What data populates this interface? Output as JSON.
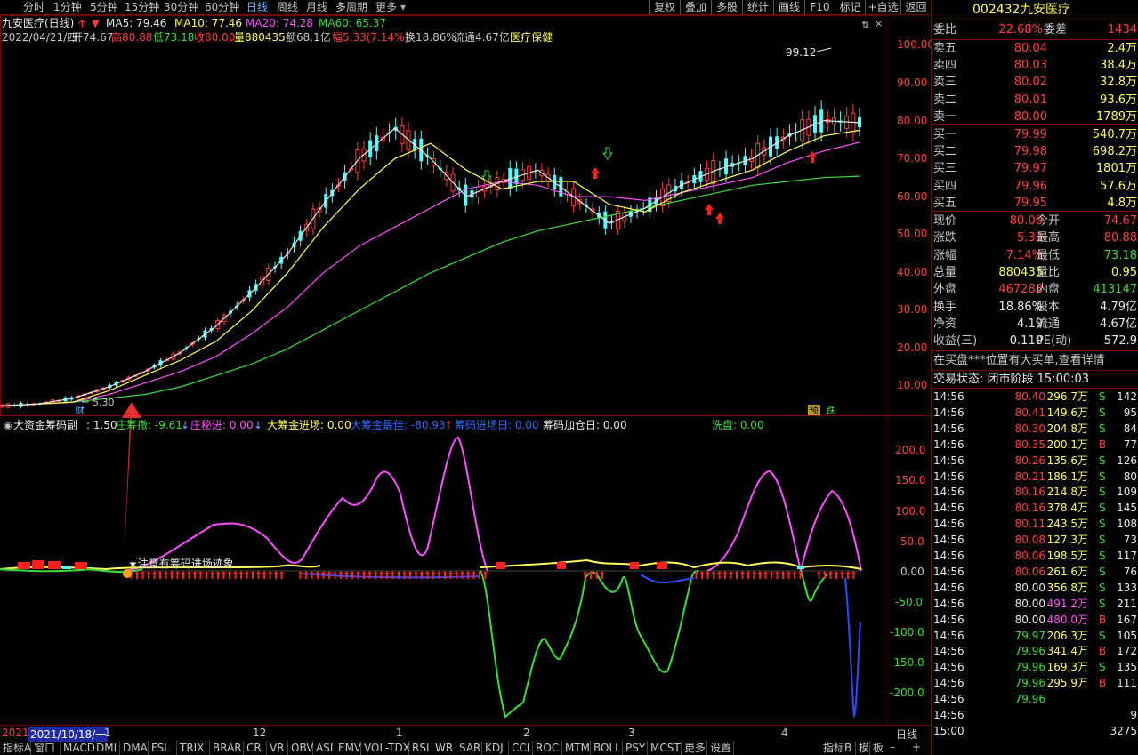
{
  "toolbar": {
    "periods": [
      "分时",
      "1分钟",
      "5分钟",
      "15分钟",
      "30分钟",
      "60分钟",
      "日线",
      "周线",
      "月线",
      "多周期",
      "更多"
    ],
    "active_period": "日线",
    "buttons": [
      "复权",
      "叠加",
      "多股",
      "统计",
      "画线",
      "F10",
      "标记",
      "+自选",
      "返回"
    ]
  },
  "main_chart": {
    "title": "九安医疗(日线)",
    "ma5": "MA5: 79.46",
    "ma10": "MA10: 77.46",
    "ma20": "MA20: 74.28",
    "ma60": "MA60: 65.37",
    "info_date": "2022/04/21/四",
    "info_open": "开74.67",
    "info_high": "高80.88",
    "info_low": "低73.18",
    "info_close": "收80.00",
    "info_vol": "量880435",
    "info_amount": "额68.1亿",
    "info_change": "幅5.33(7.14%)",
    "info_turnover": "换18.86%",
    "info_float": "流通4.67亿",
    "info_sector": "医疗保健",
    "y_labels": [
      "100.00",
      "90.00",
      "80.00",
      "70.00",
      "60.00",
      "50.00",
      "40.00",
      "30.00",
      "20.00",
      "10.00"
    ],
    "max_label": "99.12",
    "min_label": "5.30",
    "tag_cai": "财",
    "tag_yu": "预",
    "tag_die": "跌"
  },
  "chart_data": {
    "type": "line",
    "x_ticks": [
      "2021",
      "2021/10/18/一",
      "1",
      "12",
      "1",
      "2",
      "3",
      "4"
    ],
    "series": [
      {
        "name": "MA60",
        "color": "#3cdc3c",
        "values": [
          5,
          5.5,
          6,
          7,
          8,
          10,
          13,
          16,
          20,
          25,
          30,
          35,
          40,
          44,
          48,
          51,
          53,
          55,
          57,
          59,
          61,
          63,
          64,
          65,
          65.37
        ]
      },
      {
        "name": "MA20",
        "color": "#ff50ff",
        "values": [
          5,
          5.5,
          6,
          8,
          11,
          14,
          18,
          24,
          31,
          40,
          47,
          52,
          57,
          62,
          64,
          63,
          60,
          60,
          59,
          61,
          63,
          65,
          69,
          72,
          74.28
        ]
      },
      {
        "name": "MA10",
        "color": "#ffff54",
        "values": [
          5,
          5.5,
          6,
          9,
          13,
          17,
          22,
          30,
          40,
          52,
          62,
          70,
          74,
          67,
          62,
          64,
          64,
          58,
          56,
          61,
          64,
          67,
          72,
          76,
          77.46
        ]
      },
      {
        "name": "MA5",
        "color": "#e8e8e8",
        "values": [
          5,
          5.5,
          7,
          10,
          14,
          19,
          26,
          35,
          45,
          58,
          70,
          78,
          70,
          60,
          64,
          67,
          60,
          53,
          57,
          63,
          67,
          70,
          76,
          80,
          79.46
        ]
      }
    ],
    "ylim": [
      0,
      110
    ]
  },
  "indicator": {
    "title": "大资金筹码副",
    "params": ": 1.50",
    "l1": "庄筹撤: -9.61",
    "l2": "庄秘进: 0.00",
    "l3": "大筹金进场: 0.00",
    "l4": "大筹金最佳: -80.93",
    "l5": "筹码进场日: 0.00",
    "l6": "筹码加仓日: 0.00",
    "l7": "洗盘: 0.00",
    "note": "★注意有筹码进场迹象",
    "y_labels": [
      "200.0",
      "150.0",
      "100.0",
      "50.0",
      "0.00",
      "-50.0",
      "-100.0",
      "-150.0",
      "-200.0"
    ]
  },
  "right_panel": {
    "code": "002432",
    "name": "九安医疗",
    "weibi_label": "委比",
    "weibi": "22.68%",
    "weicha_label": "委差",
    "weicha": "1434",
    "asks": [
      {
        "label": "卖五",
        "price": "80.04",
        "vol": "2.4万"
      },
      {
        "label": "卖四",
        "price": "80.03",
        "vol": "38.4万"
      },
      {
        "label": "卖三",
        "price": "80.02",
        "vol": "32.8万"
      },
      {
        "label": "卖二",
        "price": "80.01",
        "vol": "93.6万"
      },
      {
        "label": "卖一",
        "price": "80.00",
        "vol": "1789万"
      }
    ],
    "bids": [
      {
        "label": "买一",
        "price": "79.99",
        "vol": "540.7万"
      },
      {
        "label": "买二",
        "price": "79.98",
        "vol": "698.2万"
      },
      {
        "label": "买三",
        "price": "79.97",
        "vol": "1801万"
      },
      {
        "label": "买四",
        "price": "79.96",
        "vol": "57.6万"
      },
      {
        "label": "买五",
        "price": "79.95",
        "vol": "4.8万"
      }
    ],
    "stats": [
      {
        "l1": "现价",
        "v1": "80.00",
        "c1": "red",
        "l2": "今开",
        "v2": "74.67",
        "c2": "red"
      },
      {
        "l1": "涨跌",
        "v1": "5.33",
        "c1": "red",
        "l2": "最高",
        "v2": "80.88",
        "c2": "red"
      },
      {
        "l1": "涨幅",
        "v1": "7.14%",
        "c1": "red",
        "l2": "最低",
        "v2": "73.18",
        "c2": "grn"
      },
      {
        "l1": "总量",
        "v1": "880435",
        "c1": "yel",
        "l2": "量比",
        "v2": "0.95",
        "c2": "yel"
      },
      {
        "l1": "外盘",
        "v1": "467288",
        "c1": "red",
        "l2": "内盘",
        "v2": "413147",
        "c2": "grn"
      },
      {
        "l1": "换手",
        "v1": "18.86%",
        "c1": "wht",
        "l2": "股本",
        "v2": "4.79亿",
        "c2": "wht"
      },
      {
        "l1": "净资",
        "v1": "4.19",
        "c1": "wht",
        "l2": "流通",
        "v2": "4.67亿",
        "c2": "wht"
      },
      {
        "l1": "收益(三)",
        "v1": "0.110",
        "c1": "wht",
        "l2": "PE(动)",
        "v2": "572.9",
        "c2": "wht"
      }
    ],
    "notice": "在买盘***位置有大买单,查看详情",
    "status": "交易状态: 闭市阶段 15:00:03",
    "ticks": [
      {
        "t": "14:56",
        "p": "80.40",
        "pc": "red",
        "v": "296.7万",
        "vc": "yel",
        "s": "S",
        "sc": "grn",
        "n": "142"
      },
      {
        "t": "14:56",
        "p": "80.41",
        "pc": "red",
        "v": "149.6万",
        "vc": "yel",
        "s": "S",
        "sc": "grn",
        "n": "95"
      },
      {
        "t": "14:56",
        "p": "80.30",
        "pc": "red",
        "v": "204.8万",
        "vc": "yel",
        "s": "S",
        "sc": "grn",
        "n": "84"
      },
      {
        "t": "14:56",
        "p": "80.35",
        "pc": "red",
        "v": "200.1万",
        "vc": "yel",
        "s": "B",
        "sc": "red",
        "n": "77"
      },
      {
        "t": "14:56",
        "p": "80.26",
        "pc": "red",
        "v": "135.6万",
        "vc": "yel",
        "s": "S",
        "sc": "grn",
        "n": "126"
      },
      {
        "t": "14:56",
        "p": "80.21",
        "pc": "red",
        "v": "186.1万",
        "vc": "yel",
        "s": "S",
        "sc": "grn",
        "n": "80"
      },
      {
        "t": "14:56",
        "p": "80.16",
        "pc": "red",
        "v": "214.8万",
        "vc": "yel",
        "s": "S",
        "sc": "grn",
        "n": "109"
      },
      {
        "t": "14:56",
        "p": "80.16",
        "pc": "red",
        "v": "378.4万",
        "vc": "yel",
        "s": "S",
        "sc": "grn",
        "n": "145"
      },
      {
        "t": "14:56",
        "p": "80.11",
        "pc": "red",
        "v": "243.5万",
        "vc": "yel",
        "s": "S",
        "sc": "grn",
        "n": "108"
      },
      {
        "t": "14:56",
        "p": "80.08",
        "pc": "red",
        "v": "127.3万",
        "vc": "yel",
        "s": "S",
        "sc": "grn",
        "n": "73"
      },
      {
        "t": "14:56",
        "p": "80.06",
        "pc": "red",
        "v": "198.5万",
        "vc": "yel",
        "s": "S",
        "sc": "grn",
        "n": "117"
      },
      {
        "t": "14:56",
        "p": "80.06",
        "pc": "red",
        "v": "261.6万",
        "vc": "yel",
        "s": "S",
        "sc": "grn",
        "n": "76"
      },
      {
        "t": "14:56",
        "p": "80.00",
        "pc": "wht",
        "v": "356.8万",
        "vc": "yel",
        "s": "S",
        "sc": "grn",
        "n": "133"
      },
      {
        "t": "14:56",
        "p": "80.00",
        "pc": "wht",
        "v": "491.2万",
        "vc": "mag",
        "s": "S",
        "sc": "grn",
        "n": "211"
      },
      {
        "t": "14:56",
        "p": "80.00",
        "pc": "wht",
        "v": "480.0万",
        "vc": "mag",
        "s": "B",
        "sc": "red",
        "n": "167"
      },
      {
        "t": "14:56",
        "p": "79.97",
        "pc": "grn",
        "v": "206.3万",
        "vc": "yel",
        "s": "S",
        "sc": "grn",
        "n": "105"
      },
      {
        "t": "14:56",
        "p": "79.96",
        "pc": "grn",
        "v": "341.4万",
        "vc": "yel",
        "s": "B",
        "sc": "red",
        "n": "172"
      },
      {
        "t": "14:56",
        "p": "79.96",
        "pc": "grn",
        "v": "169.3万",
        "vc": "yel",
        "s": "S",
        "sc": "grn",
        "n": "135"
      },
      {
        "t": "14:56",
        "p": "79.96",
        "pc": "grn",
        "v": "295.9万",
        "vc": "yel",
        "s": "B",
        "sc": "red",
        "n": "111"
      },
      {
        "t": "14:56",
        "p": "79.96",
        "pc": "grn",
        "v": "",
        "vc": "yel",
        "s": "",
        "sc": "grn",
        "n": ""
      },
      {
        "t": "14:56",
        "p": "",
        "pc": "grn",
        "v": "",
        "vc": "yel",
        "s": "",
        "sc": "grn",
        "n": "9"
      },
      {
        "t": "15:00",
        "p": "",
        "pc": "wht",
        "v": "",
        "vc": "yel",
        "s": "",
        "sc": "grn",
        "n": "3275"
      }
    ]
  },
  "bottom": {
    "period_label": "日线",
    "year_label": "2021",
    "date_label": "2021/10/18/一",
    "month_ticks": [
      "1",
      "12",
      "1",
      "2",
      "3",
      "4"
    ],
    "tabs": [
      "指标A",
      "窗口",
      "MACD",
      "DMI",
      "DMA",
      "FSL",
      "TRIX",
      "BRAR",
      "CR",
      "VR",
      "OBV",
      "ASI",
      "EMV",
      "VOL-TDX",
      "RSI",
      "WR",
      "SAR",
      "KDJ",
      "CCI",
      "ROC",
      "MTM",
      "BOLL",
      "PSY",
      "MCST",
      "更多",
      "设置"
    ],
    "right_tabs": [
      "指标B",
      "模",
      "板"
    ]
  },
  "colors": {
    "up": "#ff4040",
    "down": "#54ffff",
    "frame": "#7a0000",
    "ma5": "#e8e8e8",
    "ma10": "#ffff54",
    "ma20": "#ff50ff",
    "ma60": "#3cdc3c"
  }
}
